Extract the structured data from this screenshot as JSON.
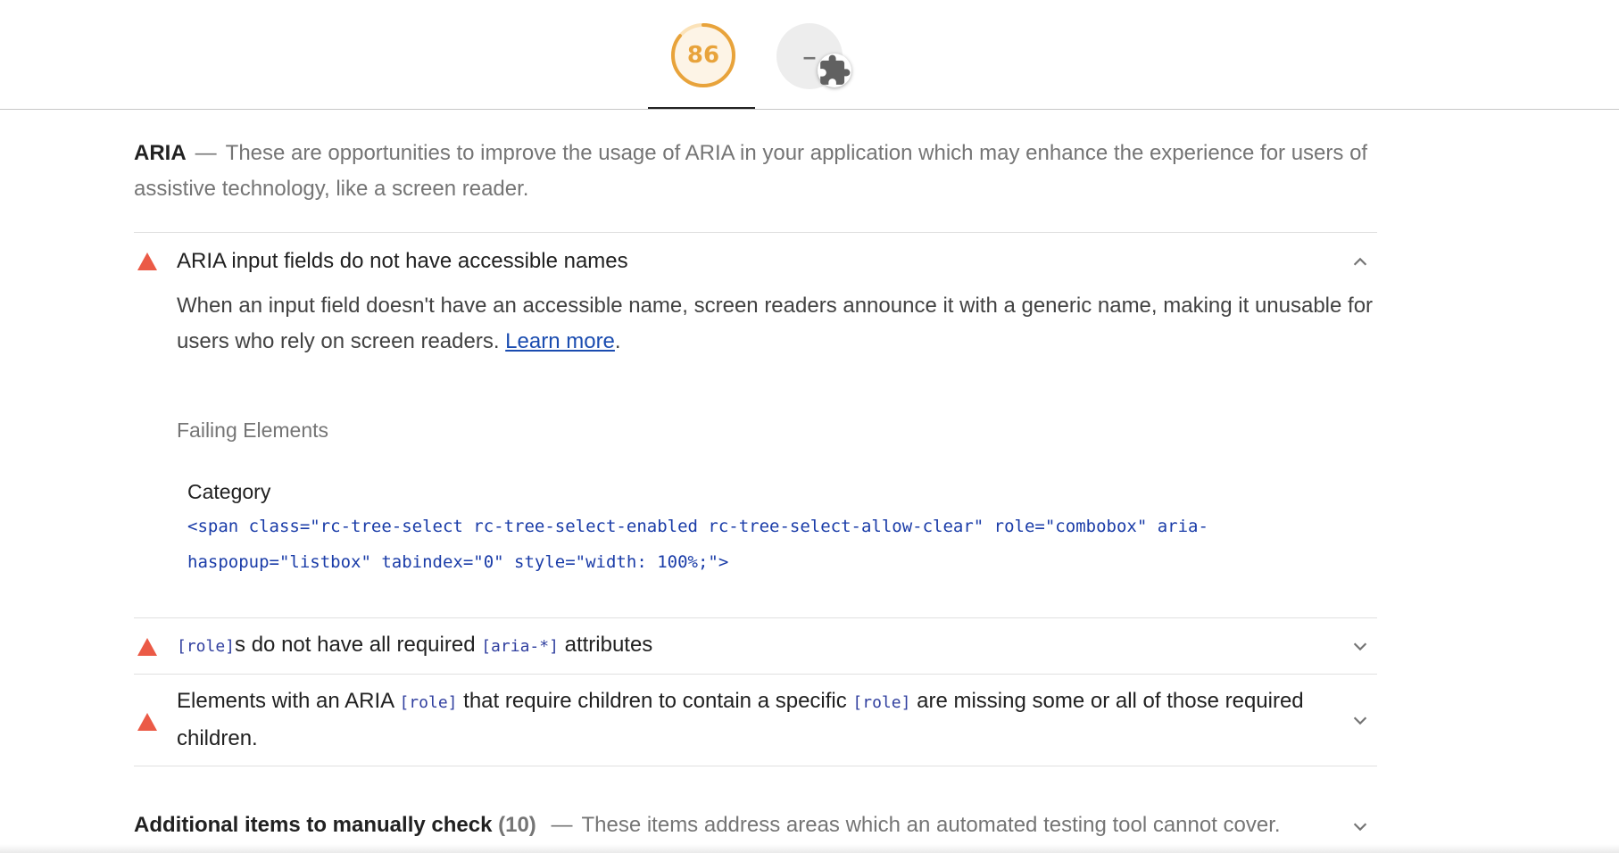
{
  "header": {
    "score": "86",
    "plugin_score": "–",
    "colors": {
      "score": "#e8a33b",
      "fail": "#eb5a46",
      "link": "#1a4cb0",
      "code": "#303f9f"
    }
  },
  "group": {
    "title": "ARIA",
    "dash": "—",
    "description": "These are opportunities to improve the usage of ARIA in your application which may enhance the experience for users of assistive technology, like a screen reader."
  },
  "audits": [
    {
      "title": "ARIA input fields do not have accessible names",
      "description": "When an input field doesn't have an accessible name, screen readers announce it with a generic name, making it unusable for users who rely on screen readers.",
      "learn_more": "Learn more",
      "after_link": ".",
      "failing_label": "Failing Elements",
      "node_label": "Category",
      "node_snippet": "<span class=\"rc-tree-select rc-tree-select-enabled rc-tree-select-allow-clear\" role=\"combobox\" aria-haspopup=\"listbox\" tabindex=\"0\" style=\"width: 100%;\">",
      "expanded": true
    },
    {
      "code1": "[role]",
      "text1": "s do not have all required ",
      "code2": "[aria-*]",
      "text2": " attributes",
      "expanded": false
    },
    {
      "text1": "Elements with an ARIA ",
      "code1": "[role]",
      "text2": " that require children to contain a specific ",
      "code2": "[role]",
      "text3": " are missing some or all of those required children.",
      "expanded": false
    }
  ],
  "manual": {
    "title": "Additional items to manually check",
    "count": "(10)",
    "dash": "—",
    "description": "These items address areas which an automated testing tool cannot cover."
  }
}
